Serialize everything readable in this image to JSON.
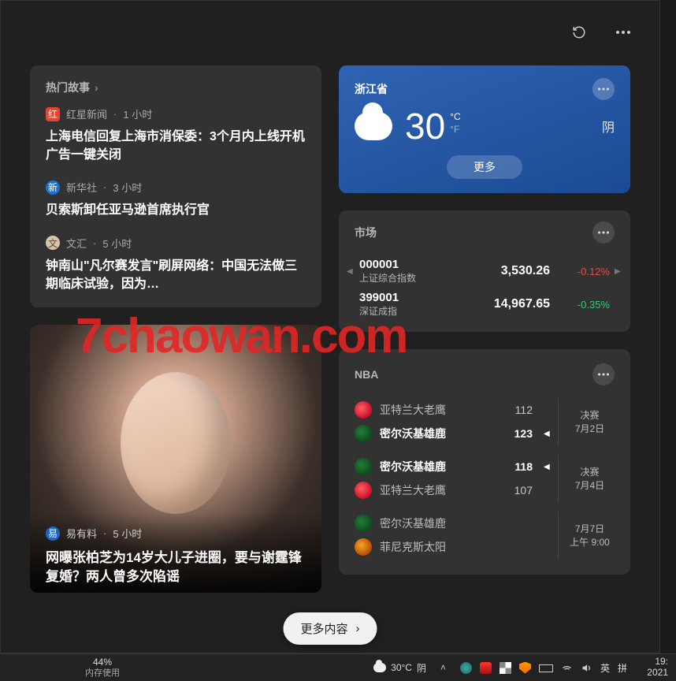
{
  "topbar": {
    "refresh_icon": "refresh-icon",
    "more_icon": "more-icon"
  },
  "hot": {
    "title": "热门故事",
    "stories": [
      {
        "source": "红星新闻",
        "time": "1 小时",
        "badge_color": "#e8432e",
        "title": "上海电信回复上海市消保委：3个月内上线开机广告一键关闭"
      },
      {
        "source": "新华社",
        "time": "3 小时",
        "badge_color": "#1472d6",
        "title": "贝索斯卸任亚马逊首席执行官"
      },
      {
        "source": "文汇",
        "time": "5 小时",
        "badge_color": "#d8c4a8",
        "title": "钟南山\"凡尔赛发言\"刷屏网络：中国无法做三期临床试验，因为…"
      }
    ]
  },
  "photo": {
    "source": "易有料",
    "time": "5 小时",
    "title": "网曝张柏芝为14岁大儿子进圈，要与谢霆锋复婚？两人曾多次陷谣"
  },
  "weather": {
    "location": "浙江省",
    "temp": "30",
    "unit_c": "°C",
    "unit_f": "°F",
    "condition": "阴",
    "more": "更多"
  },
  "market": {
    "title": "市场",
    "rows": [
      {
        "code": "000001",
        "name": "上证综合指数",
        "price": "3,530.26",
        "change": "-0.12%",
        "dir": "neg"
      },
      {
        "code": "399001",
        "name": "深证成指",
        "price": "14,967.65",
        "change": "-0.35%",
        "dir": "pos"
      }
    ]
  },
  "nba": {
    "title": "NBA",
    "games": [
      {
        "stage": "决赛",
        "date": "7月2日",
        "teams": [
          {
            "name": "亚特兰大老鹰",
            "logo": "atl",
            "score": "112",
            "win": false
          },
          {
            "name": "密尔沃基雄鹿",
            "logo": "mil",
            "score": "123",
            "win": true
          }
        ]
      },
      {
        "stage": "决赛",
        "date": "7月4日",
        "teams": [
          {
            "name": "密尔沃基雄鹿",
            "logo": "mil",
            "score": "118",
            "win": true
          },
          {
            "name": "亚特兰大老鹰",
            "logo": "atl",
            "score": "107",
            "win": false
          }
        ]
      },
      {
        "stage": "7月7日",
        "date": "上午 9:00",
        "teams": [
          {
            "name": "密尔沃基雄鹿",
            "logo": "mil",
            "score": "",
            "win": false
          },
          {
            "name": "菲尼克斯太阳",
            "logo": "phx",
            "score": "",
            "win": false
          }
        ]
      }
    ]
  },
  "more_content": "更多内容",
  "watermark": "7chaowan.com",
  "taskbar": {
    "mem_pct": "44%",
    "mem_label": "内存使用",
    "temp": "30°C",
    "cond": "阴",
    "ime1": "英",
    "ime2": "拼",
    "time": "19:",
    "date": "2021"
  }
}
